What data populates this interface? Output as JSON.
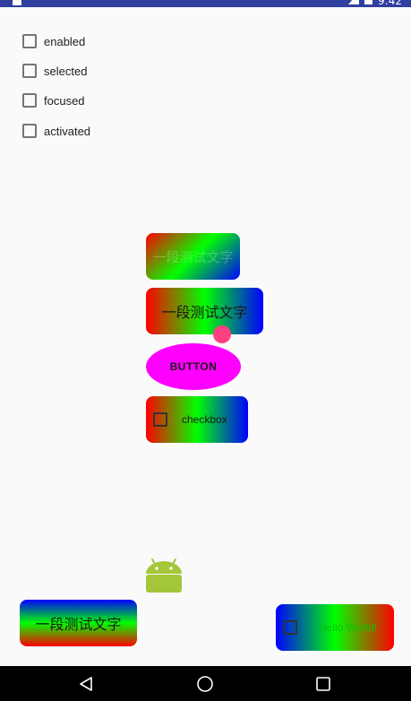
{
  "status_bar": {
    "time": "9:42"
  },
  "checkboxes": [
    {
      "label": "enabled",
      "checked": false
    },
    {
      "label": "selected",
      "checked": false
    },
    {
      "label": "focused",
      "checked": false
    },
    {
      "label": "activated",
      "checked": false
    }
  ],
  "views": {
    "faint_text": "一段测试文字",
    "gradient_text": "一段测试文字",
    "button_label": "BUTTON",
    "checkbox_label": "checkbox",
    "bottom_left_text": "一段测试文字",
    "bottom_right_text": "Hello World!"
  },
  "colors": {
    "status_bar": "#303f9f",
    "gradient_red": "#ff0000",
    "gradient_green": "#00ff00",
    "gradient_blue": "#0000ff",
    "oval_button": "#ff00ff",
    "accent_dot": "#ff4081",
    "android_green": "#a4c639"
  },
  "icons": {
    "launcher": "android-robot-icon",
    "nav_back": "back-triangle-icon",
    "nav_home": "home-circle-icon",
    "nav_recents": "recents-square-icon"
  }
}
